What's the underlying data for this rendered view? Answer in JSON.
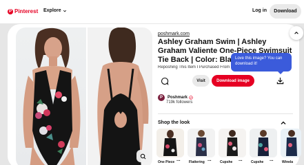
{
  "header": {
    "logo_text": "Pinterest",
    "logo_mark": "P",
    "explore_label": "Explore",
    "login_label": "Log in",
    "signup_label": "Download"
  },
  "pin": {
    "source": "poshmark.com",
    "title": "Ashley Graham Swim | Ashley Graham Valiente One-Piece Swimsuit Tie Back | Color: Black",
    "description": "Reposhing This Item I Purchased From",
    "visit_label": "Visit",
    "download_label": "Download image",
    "tooltip": "Love this image? You can download it!"
  },
  "profile": {
    "name": "Poshmark",
    "avatar_letter": "P",
    "followers": "719k followers"
  },
  "shop": {
    "title": "Shop the look",
    "items": [
      {
        "label": "One Piece"
      },
      {
        "label": "Flattering"
      },
      {
        "label": "Cupshe"
      },
      {
        "label": "Cupshe"
      },
      {
        "label": "Winela"
      }
    ]
  },
  "colors": {
    "brand": "#e60023",
    "tooltip": "#3b5bdb"
  }
}
